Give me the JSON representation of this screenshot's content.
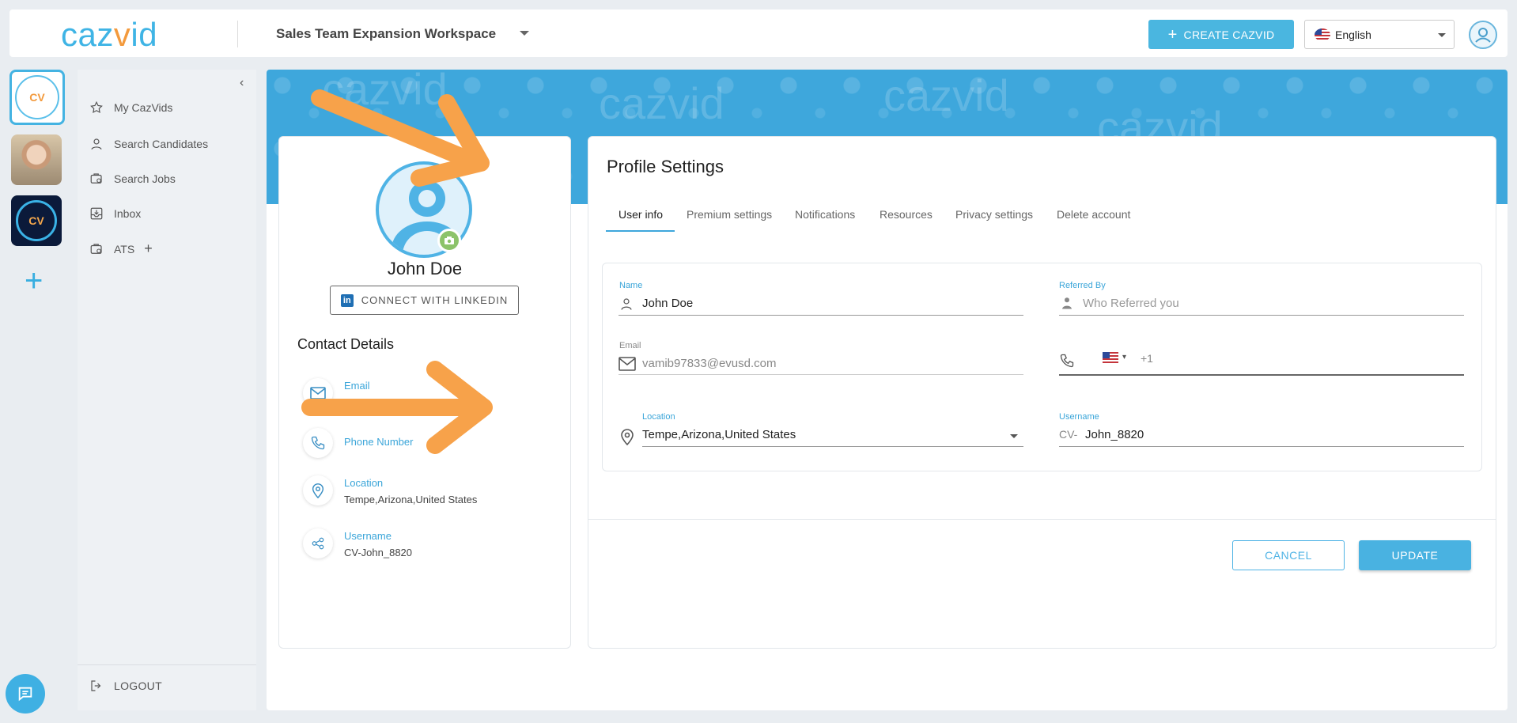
{
  "header": {
    "logo_prefix": "caz",
    "logo_o": "v",
    "logo_suffix": "id",
    "workspace": "Sales Team Expansion Workspace",
    "create_label": "CREATE CAZVID",
    "language": "English"
  },
  "rail": {
    "cv_label": "CV",
    "add_label": "+"
  },
  "sidebar": {
    "collapse_label": "‹",
    "items": [
      {
        "label": "My CazVids",
        "icon": "star-icon"
      },
      {
        "label": "Search Candidates",
        "icon": "person-icon"
      },
      {
        "label": "Search Jobs",
        "icon": "briefcase-search-icon"
      },
      {
        "label": "Inbox",
        "icon": "inbox-icon"
      },
      {
        "label": "ATS",
        "icon": "ats-icon",
        "suffix": "+"
      }
    ],
    "logout_label": "LOGOUT"
  },
  "banner": {
    "watermark": "cazvid"
  },
  "profile": {
    "name": "John Doe",
    "linkedin_label": "CONNECT WITH LINKEDIN",
    "linkedin_icon_text": "in",
    "contact_title": "Contact Details",
    "contacts": [
      {
        "label": "Email",
        "value": "",
        "icon": "mail-icon"
      },
      {
        "label": "Phone Number",
        "value": "",
        "icon": "phone-icon"
      },
      {
        "label": "Location",
        "value": "Tempe,Arizona,United States",
        "icon": "location-pin-icon"
      },
      {
        "label": "Username",
        "value": "CV-John_8820",
        "icon": "share-icon"
      }
    ]
  },
  "settings": {
    "title": "Profile Settings",
    "tabs": [
      "User info",
      "Premium settings",
      "Notifications",
      "Resources",
      "Privacy settings",
      "Delete account"
    ],
    "active_tab": "User info",
    "fields": {
      "name_label": "Name",
      "name_value": "John Doe",
      "referred_label": "Referred By",
      "referred_placeholder": "Who Referred you",
      "email_label": "Email",
      "email_value": "vamib97833@evusd.com",
      "phone_code": "+1",
      "location_label": "Location",
      "location_value": "Tempe,Arizona,United States",
      "username_label": "Username",
      "username_prefix": "CV-",
      "username_value": "John_8820"
    },
    "cancel_label": "CANCEL",
    "update_label": "UPDATE"
  },
  "colors": {
    "accent": "#3ea7dc",
    "brand_orange": "#f39a3d",
    "annotation_arrow": "#f7a24a"
  }
}
